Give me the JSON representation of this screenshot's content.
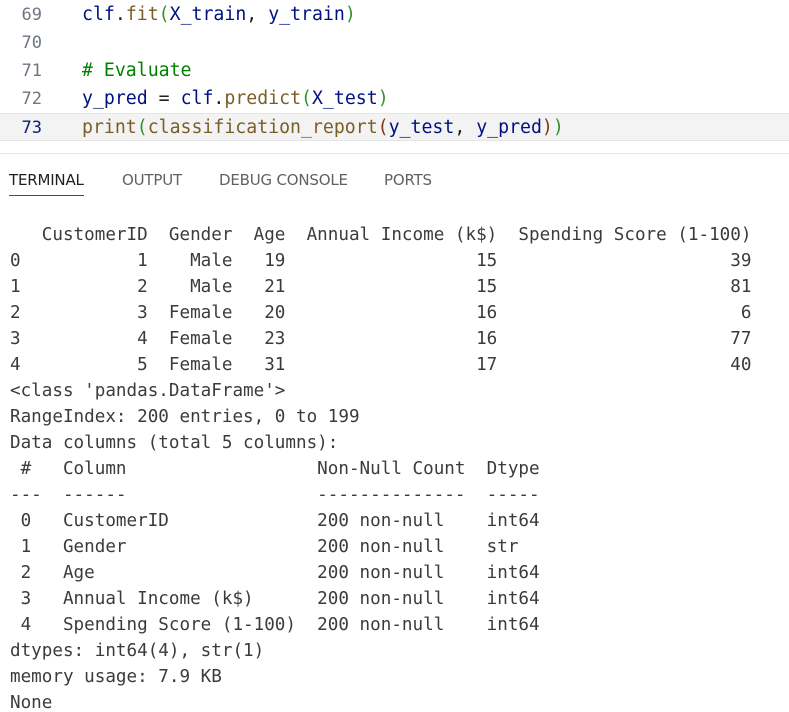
{
  "editor": {
    "lines": [
      {
        "number": "69",
        "segments": [
          {
            "t": "clf",
            "c": "var"
          },
          {
            "t": ".",
            "c": "punc"
          },
          {
            "t": "fit",
            "c": "fn"
          },
          {
            "t": "(",
            "c": "paren"
          },
          {
            "t": "X_train",
            "c": "var"
          },
          {
            "t": ", ",
            "c": "punc"
          },
          {
            "t": "y_train",
            "c": "var"
          },
          {
            "t": ")",
            "c": "paren"
          }
        ]
      },
      {
        "number": "70",
        "segments": []
      },
      {
        "number": "71",
        "segments": [
          {
            "t": "# Evaluate",
            "c": "comment"
          }
        ]
      },
      {
        "number": "72",
        "segments": [
          {
            "t": "y_pred",
            "c": "var"
          },
          {
            "t": " = ",
            "c": "punc"
          },
          {
            "t": "clf",
            "c": "var"
          },
          {
            "t": ".",
            "c": "punc"
          },
          {
            "t": "predict",
            "c": "fn"
          },
          {
            "t": "(",
            "c": "paren"
          },
          {
            "t": "X_test",
            "c": "var"
          },
          {
            "t": ")",
            "c": "paren"
          }
        ]
      },
      {
        "number": "73",
        "active": true,
        "segments": [
          {
            "t": "print",
            "c": "fn"
          },
          {
            "t": "(",
            "c": "paren"
          },
          {
            "t": "classification_report",
            "c": "fn"
          },
          {
            "t": "(",
            "c": "paren2"
          },
          {
            "t": "y_test",
            "c": "var"
          },
          {
            "t": ", ",
            "c": "punc"
          },
          {
            "t": "y_pred",
            "c": "var"
          },
          {
            "t": ")",
            "c": "paren2"
          },
          {
            "t": ")",
            "c": "paren"
          }
        ]
      }
    ]
  },
  "panel": {
    "tabs": [
      {
        "label": "TERMINAL",
        "active": true
      },
      {
        "label": "OUTPUT",
        "active": false
      },
      {
        "label": "DEBUG CONSOLE",
        "active": false
      },
      {
        "label": "PORTS",
        "active": false
      }
    ]
  },
  "terminal": {
    "lines": [
      "   CustomerID  Gender  Age  Annual Income (k$)  Spending Score (1-100)",
      "0           1    Male   19                  15                      39",
      "1           2    Male   21                  15                      81",
      "2           3  Female   20                  16                       6",
      "3           4  Female   23                  16                      77",
      "4           5  Female   31                  17                      40",
      "<class 'pandas.DataFrame'>",
      "RangeIndex: 200 entries, 0 to 199",
      "Data columns (total 5 columns):",
      " #   Column                  Non-Null Count  Dtype",
      "---  ------                  --------------  -----",
      " 0   CustomerID              200 non-null    int64",
      " 1   Gender                  200 non-null    str",
      " 2   Age                     200 non-null    int64",
      " 3   Annual Income (k$)      200 non-null    int64",
      " 4   Spending Score (1-100)  200 non-null    int64",
      "dtypes: int64(4), str(1)",
      "memory usage: 7.9 KB",
      "None"
    ]
  },
  "colors": {
    "tab_active_underline": "#005fb8",
    "comment": "#008000",
    "function": "#795e26",
    "variable": "#001080"
  }
}
